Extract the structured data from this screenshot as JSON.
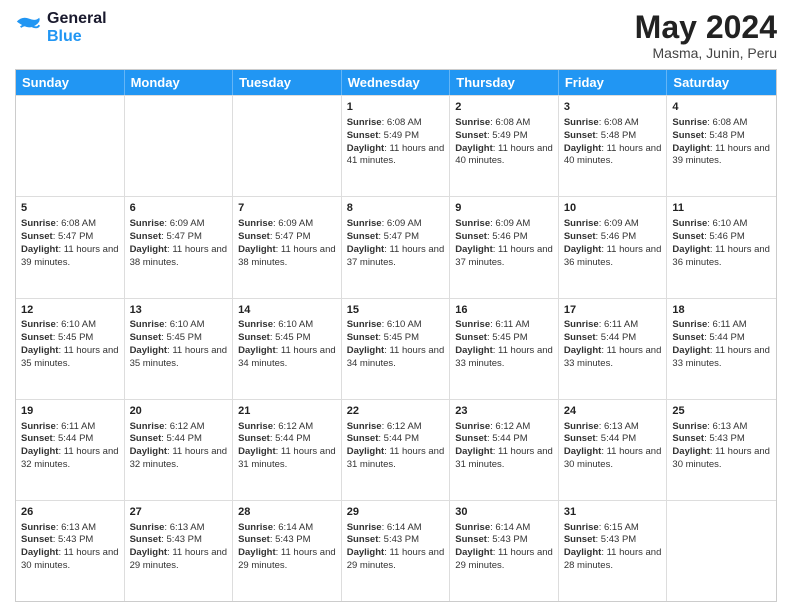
{
  "header": {
    "logo_line1": "General",
    "logo_line2": "Blue",
    "month_year": "May 2024",
    "location": "Masma, Junin, Peru"
  },
  "days_of_week": [
    "Sunday",
    "Monday",
    "Tuesday",
    "Wednesday",
    "Thursday",
    "Friday",
    "Saturday"
  ],
  "rows": [
    [
      {
        "day": "",
        "info": ""
      },
      {
        "day": "",
        "info": ""
      },
      {
        "day": "",
        "info": ""
      },
      {
        "day": "1",
        "info": "Sunrise: 6:08 AM\nSunset: 5:49 PM\nDaylight: 11 hours and 41 minutes."
      },
      {
        "day": "2",
        "info": "Sunrise: 6:08 AM\nSunset: 5:49 PM\nDaylight: 11 hours and 40 minutes."
      },
      {
        "day": "3",
        "info": "Sunrise: 6:08 AM\nSunset: 5:48 PM\nDaylight: 11 hours and 40 minutes."
      },
      {
        "day": "4",
        "info": "Sunrise: 6:08 AM\nSunset: 5:48 PM\nDaylight: 11 hours and 39 minutes."
      }
    ],
    [
      {
        "day": "5",
        "info": "Sunrise: 6:08 AM\nSunset: 5:47 PM\nDaylight: 11 hours and 39 minutes."
      },
      {
        "day": "6",
        "info": "Sunrise: 6:09 AM\nSunset: 5:47 PM\nDaylight: 11 hours and 38 minutes."
      },
      {
        "day": "7",
        "info": "Sunrise: 6:09 AM\nSunset: 5:47 PM\nDaylight: 11 hours and 38 minutes."
      },
      {
        "day": "8",
        "info": "Sunrise: 6:09 AM\nSunset: 5:47 PM\nDaylight: 11 hours and 37 minutes."
      },
      {
        "day": "9",
        "info": "Sunrise: 6:09 AM\nSunset: 5:46 PM\nDaylight: 11 hours and 37 minutes."
      },
      {
        "day": "10",
        "info": "Sunrise: 6:09 AM\nSunset: 5:46 PM\nDaylight: 11 hours and 36 minutes."
      },
      {
        "day": "11",
        "info": "Sunrise: 6:10 AM\nSunset: 5:46 PM\nDaylight: 11 hours and 36 minutes."
      }
    ],
    [
      {
        "day": "12",
        "info": "Sunrise: 6:10 AM\nSunset: 5:45 PM\nDaylight: 11 hours and 35 minutes."
      },
      {
        "day": "13",
        "info": "Sunrise: 6:10 AM\nSunset: 5:45 PM\nDaylight: 11 hours and 35 minutes."
      },
      {
        "day": "14",
        "info": "Sunrise: 6:10 AM\nSunset: 5:45 PM\nDaylight: 11 hours and 34 minutes."
      },
      {
        "day": "15",
        "info": "Sunrise: 6:10 AM\nSunset: 5:45 PM\nDaylight: 11 hours and 34 minutes."
      },
      {
        "day": "16",
        "info": "Sunrise: 6:11 AM\nSunset: 5:45 PM\nDaylight: 11 hours and 33 minutes."
      },
      {
        "day": "17",
        "info": "Sunrise: 6:11 AM\nSunset: 5:44 PM\nDaylight: 11 hours and 33 minutes."
      },
      {
        "day": "18",
        "info": "Sunrise: 6:11 AM\nSunset: 5:44 PM\nDaylight: 11 hours and 33 minutes."
      }
    ],
    [
      {
        "day": "19",
        "info": "Sunrise: 6:11 AM\nSunset: 5:44 PM\nDaylight: 11 hours and 32 minutes."
      },
      {
        "day": "20",
        "info": "Sunrise: 6:12 AM\nSunset: 5:44 PM\nDaylight: 11 hours and 32 minutes."
      },
      {
        "day": "21",
        "info": "Sunrise: 6:12 AM\nSunset: 5:44 PM\nDaylight: 11 hours and 31 minutes."
      },
      {
        "day": "22",
        "info": "Sunrise: 6:12 AM\nSunset: 5:44 PM\nDaylight: 11 hours and 31 minutes."
      },
      {
        "day": "23",
        "info": "Sunrise: 6:12 AM\nSunset: 5:44 PM\nDaylight: 11 hours and 31 minutes."
      },
      {
        "day": "24",
        "info": "Sunrise: 6:13 AM\nSunset: 5:44 PM\nDaylight: 11 hours and 30 minutes."
      },
      {
        "day": "25",
        "info": "Sunrise: 6:13 AM\nSunset: 5:43 PM\nDaylight: 11 hours and 30 minutes."
      }
    ],
    [
      {
        "day": "26",
        "info": "Sunrise: 6:13 AM\nSunset: 5:43 PM\nDaylight: 11 hours and 30 minutes."
      },
      {
        "day": "27",
        "info": "Sunrise: 6:13 AM\nSunset: 5:43 PM\nDaylight: 11 hours and 29 minutes."
      },
      {
        "day": "28",
        "info": "Sunrise: 6:14 AM\nSunset: 5:43 PM\nDaylight: 11 hours and 29 minutes."
      },
      {
        "day": "29",
        "info": "Sunrise: 6:14 AM\nSunset: 5:43 PM\nDaylight: 11 hours and 29 minutes."
      },
      {
        "day": "30",
        "info": "Sunrise: 6:14 AM\nSunset: 5:43 PM\nDaylight: 11 hours and 29 minutes."
      },
      {
        "day": "31",
        "info": "Sunrise: 6:15 AM\nSunset: 5:43 PM\nDaylight: 11 hours and 28 minutes."
      },
      {
        "day": "",
        "info": ""
      }
    ]
  ]
}
